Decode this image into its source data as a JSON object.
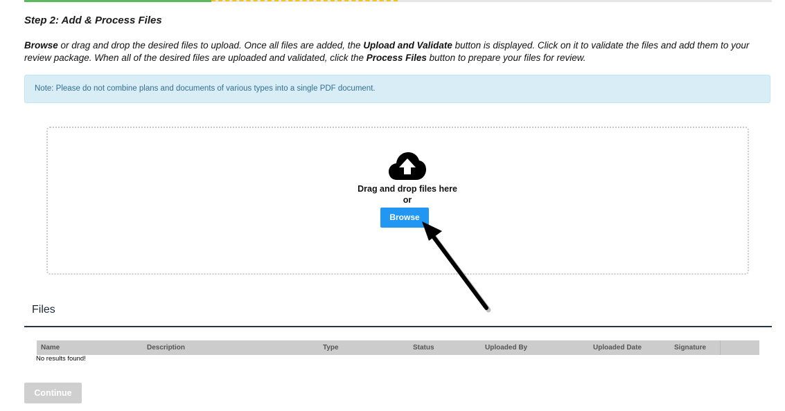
{
  "progress": {
    "completed_color": "#5cb85c",
    "current_color": "#f0c419"
  },
  "step": {
    "title": "Step 2: Add & Process Files"
  },
  "instructions": {
    "part1": "Browse",
    "part2": " or drag and drop the desired files to upload. Once all files are added, the ",
    "part3": "Upload and Validate",
    "part4": " button is displayed. Click on it to validate the files and add them to your review package. When all of the desired files are uploaded and validated, click the ",
    "part5": "Process Files",
    "part6": " button to prepare your files for review."
  },
  "note": {
    "text": "Note: Please do not combine plans and documents of various types into a single PDF document."
  },
  "dropzone": {
    "icon": "cloud-upload-icon",
    "drag_text": "Drag and drop files here",
    "or_text": "or",
    "browse_label": "Browse",
    "browse_color": "#2196f3"
  },
  "files": {
    "heading": "Files",
    "columns": [
      "Name",
      "Description",
      "Type",
      "Status",
      "Uploaded By",
      "Uploaded Date",
      "Signature"
    ],
    "empty_text": "No results found!"
  },
  "footer": {
    "continue_label": "Continue"
  }
}
